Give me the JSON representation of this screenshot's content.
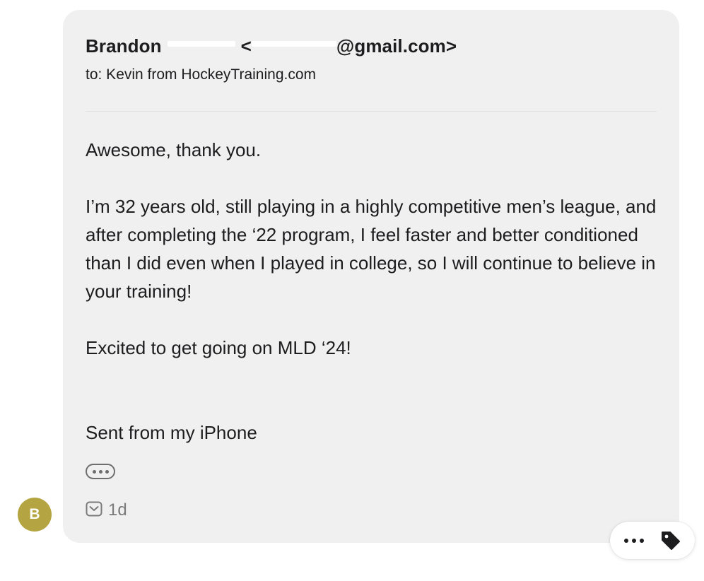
{
  "message": {
    "sender_name": "Brandon",
    "sender_email_tail": "@gmail.com>",
    "sender_email_open": "<",
    "recipient": "to: Kevin from HockeyTraining.com",
    "body": {
      "p1": "Awesome, thank you.",
      "p2": "I’m 32 years old, still playing in a highly competitive men’s league, and after completing the ‘22 program, I feel faster and better conditioned than I did even when I played in college, so I will continue to believe in your training!",
      "p3": "Excited to get going on MLD ‘24!",
      "signature": "Sent from my iPhone"
    },
    "timestamp": "1d"
  },
  "avatar": {
    "initial": "B",
    "color": "#b4a542"
  },
  "icons": {
    "expand": "ellipsis-pill-icon",
    "status": "envelope-check-icon",
    "more": "more-dots-icon",
    "tag": "tag-icon"
  },
  "colors": {
    "card_background": "#f0f0f0",
    "muted_text": "#7a7a7a"
  }
}
